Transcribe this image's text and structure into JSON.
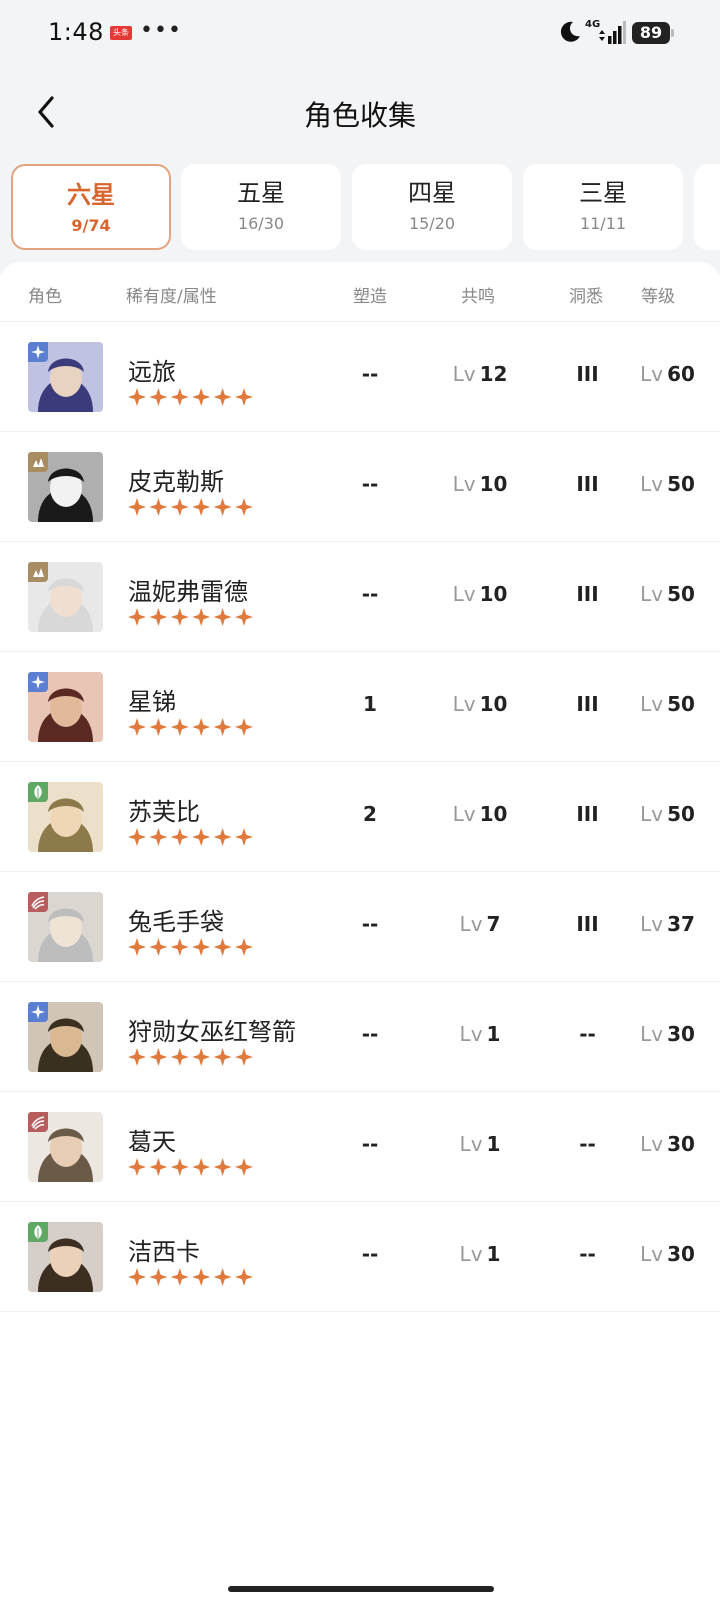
{
  "status_bar": {
    "time": "1:48",
    "news_badge": "头条",
    "dots": "•••",
    "network": "4G",
    "battery": "89",
    "icons": [
      "news-icon",
      "moon-icon",
      "signal-icon",
      "battery-icon"
    ]
  },
  "header": {
    "title": "角色收集",
    "back_icon": "chevron-left-icon"
  },
  "tabs": [
    {
      "label": "六星",
      "count": "9/74",
      "active": true
    },
    {
      "label": "五星",
      "count": "16/30",
      "active": false
    },
    {
      "label": "四星",
      "count": "15/20",
      "active": false
    },
    {
      "label": "三星",
      "count": "11/11",
      "active": false
    }
  ],
  "table": {
    "columns": {
      "role": "角色",
      "rarity": "稀有度/属性",
      "shaping": "塑造",
      "resonance": "共鸣",
      "insight": "洞悉",
      "level": "等级"
    },
    "lv_prefix": "Lv",
    "rows": [
      {
        "name": "远旅",
        "element": "star",
        "shaping": "--",
        "resonance": "12",
        "insight": "III",
        "level": "60"
      },
      {
        "name": "皮克勒斯",
        "element": "mineral",
        "shaping": "--",
        "resonance": "10",
        "insight": "III",
        "level": "50"
      },
      {
        "name": "温妮弗雷德",
        "element": "mineral",
        "shaping": "--",
        "resonance": "10",
        "insight": "III",
        "level": "50"
      },
      {
        "name": "星锑",
        "element": "star",
        "shaping": "1",
        "resonance": "10",
        "insight": "III",
        "level": "50"
      },
      {
        "name": "苏芙比",
        "element": "plant",
        "shaping": "2",
        "resonance": "10",
        "insight": "III",
        "level": "50"
      },
      {
        "name": "兔毛手袋",
        "element": "beast",
        "shaping": "--",
        "resonance": "7",
        "insight": "III",
        "level": "37"
      },
      {
        "name": "狩勋女巫红弩箭",
        "element": "star",
        "shaping": "--",
        "resonance": "1",
        "insight": "--",
        "level": "30"
      },
      {
        "name": "葛天",
        "element": "beast",
        "shaping": "--",
        "resonance": "1",
        "insight": "--",
        "level": "30"
      },
      {
        "name": "洁西卡",
        "element": "plant",
        "shaping": "--",
        "resonance": "1",
        "insight": "--",
        "level": "30"
      }
    ]
  },
  "colors": {
    "accent": "#d8652c",
    "star": "#e07a3c",
    "element_star": "#5a7fd0",
    "element_mineral": "#a88c62",
    "element_plant": "#5fa865",
    "element_beast": "#b85d5d"
  }
}
